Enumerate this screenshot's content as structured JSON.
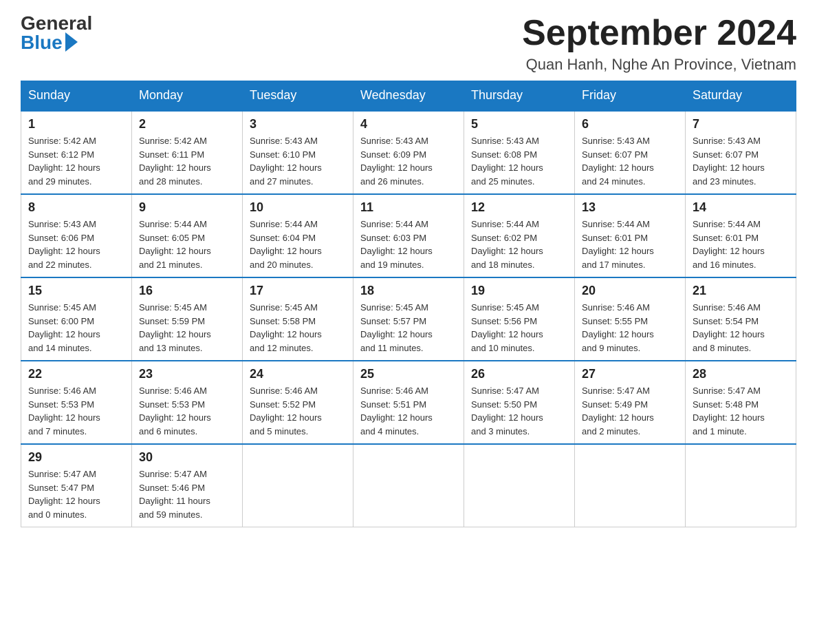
{
  "header": {
    "logo_general": "General",
    "logo_blue": "Blue",
    "title": "September 2024",
    "subtitle": "Quan Hanh, Nghe An Province, Vietnam"
  },
  "weekdays": [
    "Sunday",
    "Monday",
    "Tuesday",
    "Wednesday",
    "Thursday",
    "Friday",
    "Saturday"
  ],
  "weeks": [
    [
      {
        "day": "1",
        "sunrise": "5:42 AM",
        "sunset": "6:12 PM",
        "daylight": "12 hours and 29 minutes."
      },
      {
        "day": "2",
        "sunrise": "5:42 AM",
        "sunset": "6:11 PM",
        "daylight": "12 hours and 28 minutes."
      },
      {
        "day": "3",
        "sunrise": "5:43 AM",
        "sunset": "6:10 PM",
        "daylight": "12 hours and 27 minutes."
      },
      {
        "day": "4",
        "sunrise": "5:43 AM",
        "sunset": "6:09 PM",
        "daylight": "12 hours and 26 minutes."
      },
      {
        "day": "5",
        "sunrise": "5:43 AM",
        "sunset": "6:08 PM",
        "daylight": "12 hours and 25 minutes."
      },
      {
        "day": "6",
        "sunrise": "5:43 AM",
        "sunset": "6:07 PM",
        "daylight": "12 hours and 24 minutes."
      },
      {
        "day": "7",
        "sunrise": "5:43 AM",
        "sunset": "6:07 PM",
        "daylight": "12 hours and 23 minutes."
      }
    ],
    [
      {
        "day": "8",
        "sunrise": "5:43 AM",
        "sunset": "6:06 PM",
        "daylight": "12 hours and 22 minutes."
      },
      {
        "day": "9",
        "sunrise": "5:44 AM",
        "sunset": "6:05 PM",
        "daylight": "12 hours and 21 minutes."
      },
      {
        "day": "10",
        "sunrise": "5:44 AM",
        "sunset": "6:04 PM",
        "daylight": "12 hours and 20 minutes."
      },
      {
        "day": "11",
        "sunrise": "5:44 AM",
        "sunset": "6:03 PM",
        "daylight": "12 hours and 19 minutes."
      },
      {
        "day": "12",
        "sunrise": "5:44 AM",
        "sunset": "6:02 PM",
        "daylight": "12 hours and 18 minutes."
      },
      {
        "day": "13",
        "sunrise": "5:44 AM",
        "sunset": "6:01 PM",
        "daylight": "12 hours and 17 minutes."
      },
      {
        "day": "14",
        "sunrise": "5:44 AM",
        "sunset": "6:01 PM",
        "daylight": "12 hours and 16 minutes."
      }
    ],
    [
      {
        "day": "15",
        "sunrise": "5:45 AM",
        "sunset": "6:00 PM",
        "daylight": "12 hours and 14 minutes."
      },
      {
        "day": "16",
        "sunrise": "5:45 AM",
        "sunset": "5:59 PM",
        "daylight": "12 hours and 13 minutes."
      },
      {
        "day": "17",
        "sunrise": "5:45 AM",
        "sunset": "5:58 PM",
        "daylight": "12 hours and 12 minutes."
      },
      {
        "day": "18",
        "sunrise": "5:45 AM",
        "sunset": "5:57 PM",
        "daylight": "12 hours and 11 minutes."
      },
      {
        "day": "19",
        "sunrise": "5:45 AM",
        "sunset": "5:56 PM",
        "daylight": "12 hours and 10 minutes."
      },
      {
        "day": "20",
        "sunrise": "5:46 AM",
        "sunset": "5:55 PM",
        "daylight": "12 hours and 9 minutes."
      },
      {
        "day": "21",
        "sunrise": "5:46 AM",
        "sunset": "5:54 PM",
        "daylight": "12 hours and 8 minutes."
      }
    ],
    [
      {
        "day": "22",
        "sunrise": "5:46 AM",
        "sunset": "5:53 PM",
        "daylight": "12 hours and 7 minutes."
      },
      {
        "day": "23",
        "sunrise": "5:46 AM",
        "sunset": "5:53 PM",
        "daylight": "12 hours and 6 minutes."
      },
      {
        "day": "24",
        "sunrise": "5:46 AM",
        "sunset": "5:52 PM",
        "daylight": "12 hours and 5 minutes."
      },
      {
        "day": "25",
        "sunrise": "5:46 AM",
        "sunset": "5:51 PM",
        "daylight": "12 hours and 4 minutes."
      },
      {
        "day": "26",
        "sunrise": "5:47 AM",
        "sunset": "5:50 PM",
        "daylight": "12 hours and 3 minutes."
      },
      {
        "day": "27",
        "sunrise": "5:47 AM",
        "sunset": "5:49 PM",
        "daylight": "12 hours and 2 minutes."
      },
      {
        "day": "28",
        "sunrise": "5:47 AM",
        "sunset": "5:48 PM",
        "daylight": "12 hours and 1 minute."
      }
    ],
    [
      {
        "day": "29",
        "sunrise": "5:47 AM",
        "sunset": "5:47 PM",
        "daylight": "12 hours and 0 minutes."
      },
      {
        "day": "30",
        "sunrise": "5:47 AM",
        "sunset": "5:46 PM",
        "daylight": "11 hours and 59 minutes."
      },
      null,
      null,
      null,
      null,
      null
    ]
  ]
}
